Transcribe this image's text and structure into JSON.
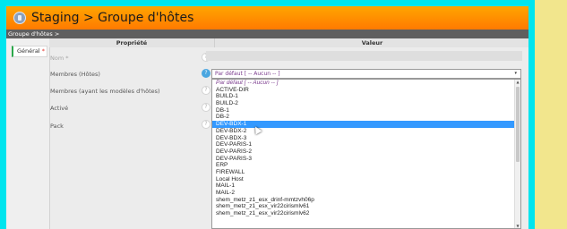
{
  "header": {
    "title": "Staging > Groupe d'hôtes",
    "icon": "app-icon"
  },
  "breadcrumb": "Groupe d'hôtes >",
  "tabs": [
    {
      "label": "Général",
      "required_mark": "*"
    }
  ],
  "table": {
    "col_property": "Propriété",
    "col_value": "Valeur"
  },
  "properties": [
    {
      "label": "Nom *"
    },
    {
      "label": "Membres (Hôtes)"
    },
    {
      "label": "Membres (ayant les modèles d'hôtes)"
    },
    {
      "label": "Activé"
    },
    {
      "label": "Pack"
    }
  ],
  "help_glyph": "?",
  "select": {
    "value": "Par défaut [ -- Aucun -- ]",
    "arrow": "▾"
  },
  "options": [
    "Par défaut [ -- Aucun -- ]",
    "ACTIVE-DIR",
    "BUILD-1",
    "BUILD-2",
    "DB-1",
    "DB-2",
    "DEV-BDX-1",
    "DEV-BDX-2",
    "DEV-BDX-3",
    "DEV-PARIS-1",
    "DEV-PARIS-2",
    "DEV-PARIS-3",
    "ERP",
    "FIREWALL",
    "Local Host",
    "MAIL-1",
    "MAIL-2",
    "shem_metz_z1_esx_drinf-mmtzvh06p",
    "shem_metz_z1_esx_vir22cirismlv61",
    "shem_metz_z1_esx_vir22cirismlv62"
  ],
  "selected_option": "DEV-BDX-1",
  "scroll": {
    "up": "▲",
    "down": "▼"
  },
  "colors": {
    "background": "#00e5ee",
    "header_orange": "#ff8c00",
    "selection": "#3399ff",
    "default_option": "#7b3b8e",
    "tab_accent": "#2ba84a",
    "right_panel": "#f2e68d"
  }
}
